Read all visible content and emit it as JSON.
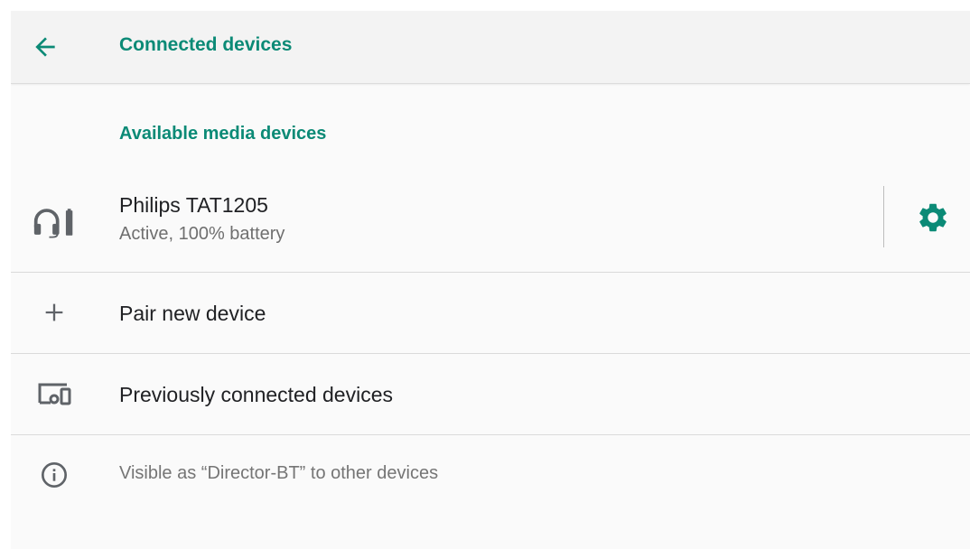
{
  "appbar": {
    "title": "Connected devices",
    "back_icon": "arrow-back-icon"
  },
  "media_section": {
    "header": "Available media devices",
    "device": {
      "name": "Philips TAT1205",
      "status": "Active, 100% battery",
      "icon": "headset-battery-icon",
      "settings_icon": "gear-icon"
    }
  },
  "pair_new": {
    "label": "Pair new device",
    "icon": "plus-icon"
  },
  "previously_connected": {
    "label": "Previously connected devices",
    "icon": "devices-icon"
  },
  "footer": {
    "text": "Visible as “Director-BT” to other devices",
    "icon": "info-icon"
  },
  "colors": {
    "accent": "#0b8a76",
    "icon_gray": "#5f6368",
    "background": "#fafafa"
  }
}
